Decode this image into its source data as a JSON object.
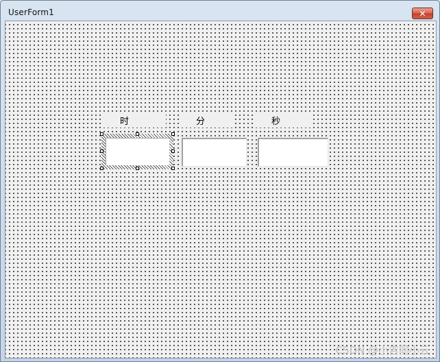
{
  "window": {
    "title": "UserForm1",
    "close_label": "✕"
  },
  "form": {
    "labels": [
      {
        "id": "hour",
        "text": "时"
      },
      {
        "id": "minute",
        "text": "分"
      },
      {
        "id": "second",
        "text": "秒"
      }
    ],
    "textboxes": [
      {
        "id": "hour",
        "value": "",
        "selected": true
      },
      {
        "id": "minute",
        "value": "",
        "selected": false
      },
      {
        "id": "second",
        "value": "",
        "selected": false
      }
    ]
  },
  "watermark": "CSDN @小吉同小云"
}
